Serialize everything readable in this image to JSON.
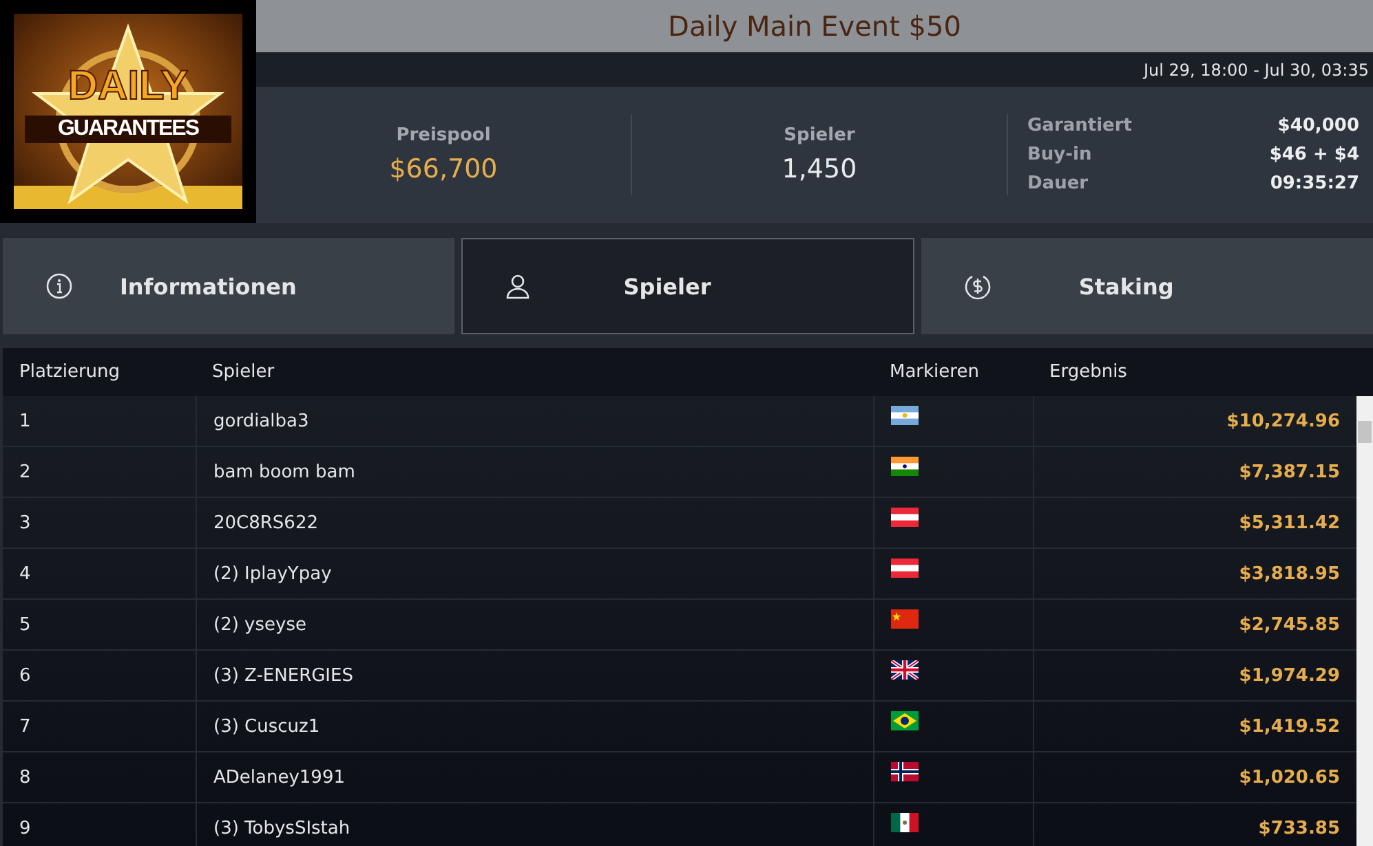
{
  "logo": {
    "line_1": "DAILY",
    "line_2": "GUARANTEES"
  },
  "title": "Daily Main Event $50",
  "date_range": "Jul 29, 18:00 - Jul 30, 03:35",
  "stats": [
    {
      "label": "Preispool",
      "value": "$66,700",
      "kind": "prize"
    },
    {
      "label": "Spieler",
      "value": "1,450",
      "kind": "count"
    }
  ],
  "details": [
    {
      "label": "Garantiert",
      "value": "$40,000"
    },
    {
      "label": "Buy-in",
      "value": "$46 + $4"
    },
    {
      "label": "Dauer",
      "value": "09:35:27"
    }
  ],
  "tabs": [
    {
      "label": "Informationen",
      "kind": "info",
      "selected": false
    },
    {
      "label": "Spieler",
      "kind": "person",
      "selected": true
    },
    {
      "label": "Staking",
      "kind": "dollar",
      "selected": false
    }
  ],
  "table": {
    "columns": [
      "Platzierung",
      "Spieler",
      "Markieren",
      "Ergebnis"
    ],
    "rows": [
      {
        "place": "1",
        "player": "gordialba3",
        "kind": "ar",
        "result": "$10,274.96"
      },
      {
        "place": "2",
        "player": "bam boom bam",
        "kind": "in",
        "result": "$7,387.15"
      },
      {
        "place": "3",
        "player": "20C8RS622",
        "kind": "at",
        "result": "$5,311.42"
      },
      {
        "place": "4",
        "player": "(2) IplayYpay",
        "kind": "at",
        "result": "$3,818.95"
      },
      {
        "place": "5",
        "player": "(2) yseyse",
        "kind": "cn",
        "result": "$2,745.85"
      },
      {
        "place": "6",
        "player": "(3) Z-ENERGIES",
        "kind": "gb",
        "result": "$1,974.29"
      },
      {
        "place": "7",
        "player": "(3) Cuscuz1",
        "kind": "br",
        "result": "$1,419.52"
      },
      {
        "place": "8",
        "player": "ADelaney1991",
        "kind": "no",
        "result": "$1,020.65"
      },
      {
        "place": "9",
        "player": "(3) TobysSIstah",
        "kind": "mx",
        "result": "$733.85"
      }
    ]
  }
}
